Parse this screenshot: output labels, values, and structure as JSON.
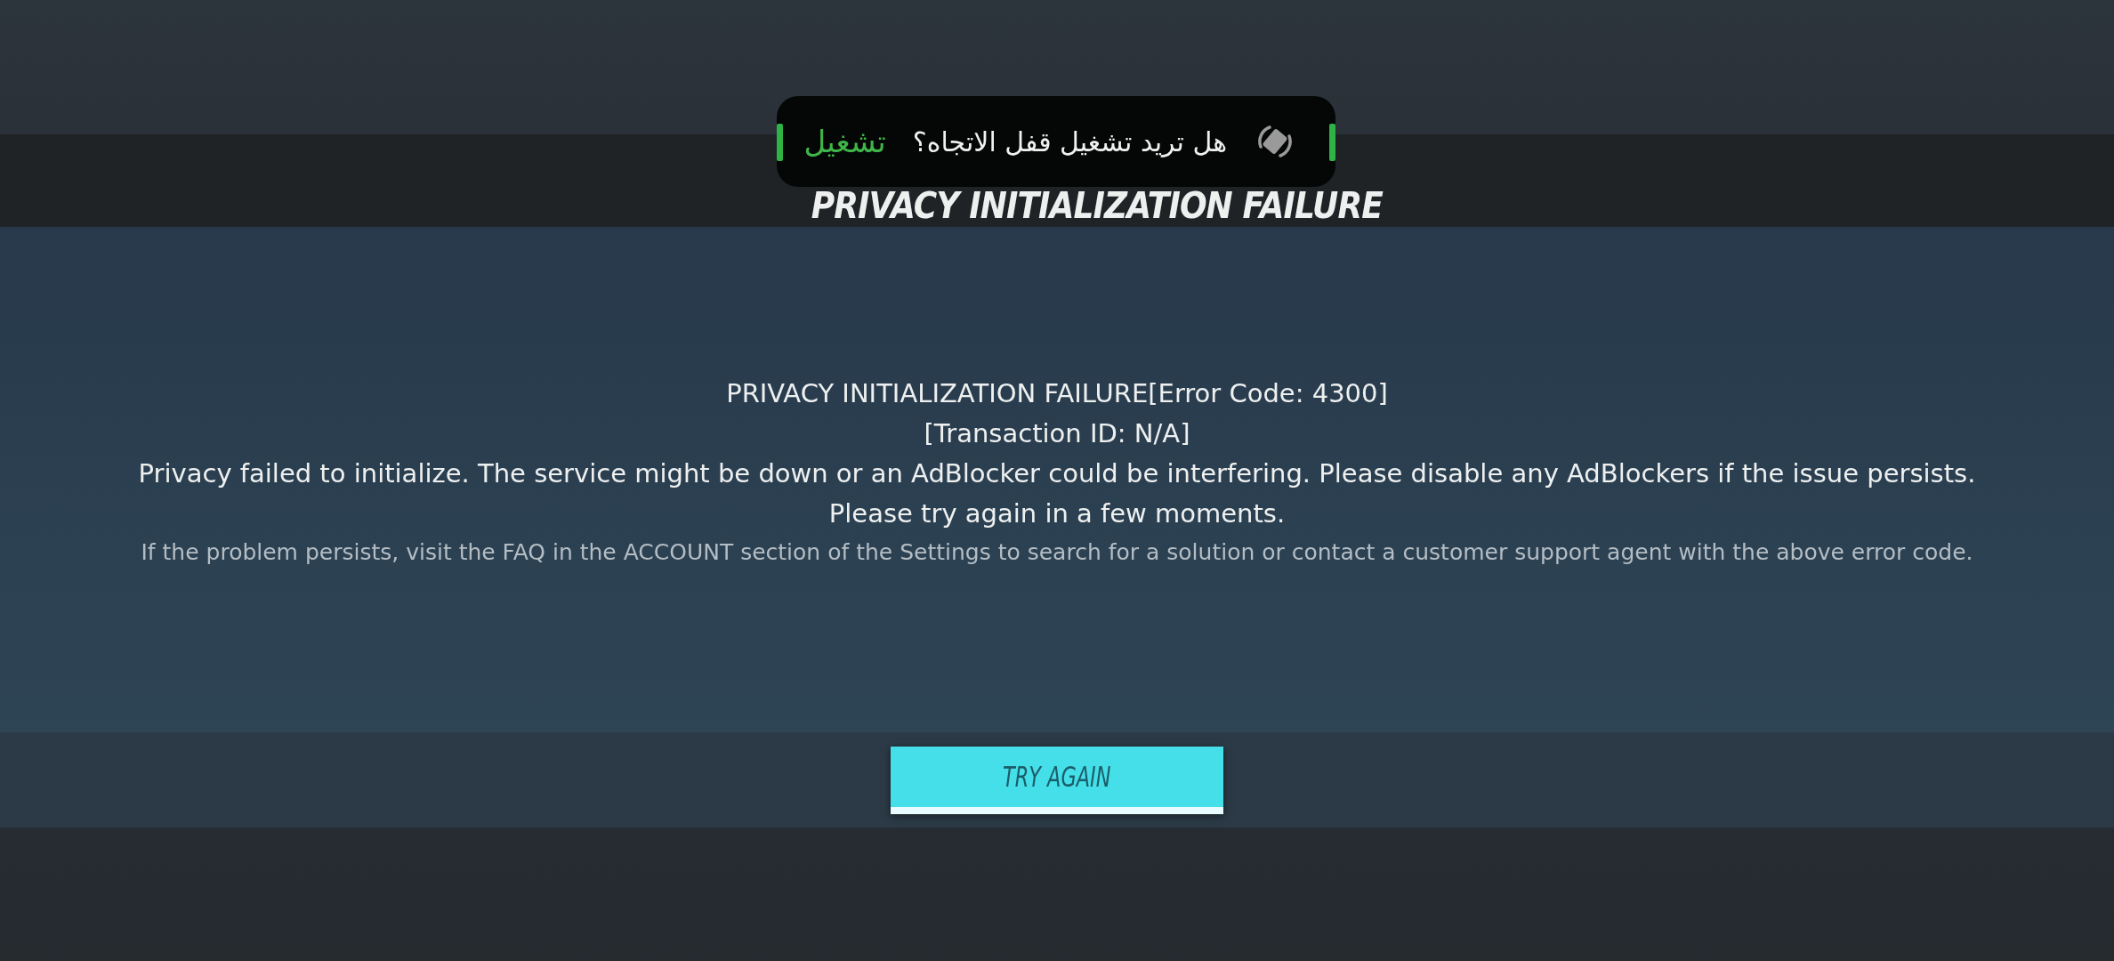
{
  "header": {
    "title": "PRIVACY INITIALIZATION FAILURE"
  },
  "toast": {
    "message": "هل تريد تشغيل قفل الاتجاه؟",
    "action": "تشغيل"
  },
  "error": {
    "heading": "PRIVACY INITIALIZATION FAILURE[Error Code: 4300]",
    "transaction": "[Transaction ID: N/A]",
    "description": "Privacy failed to initialize. The service might be down or an AdBlocker could be interfering. Please disable any AdBlockers if the issue persists.",
    "retry_hint": "Please try again in a few moments.",
    "help": "If the problem persists, visit the FAQ in the ACCOUNT section of the Settings to search for a solution or contact a customer support agent with the above error code."
  },
  "buttons": [
    {
      "label": "TRY AGAIN"
    }
  ]
}
